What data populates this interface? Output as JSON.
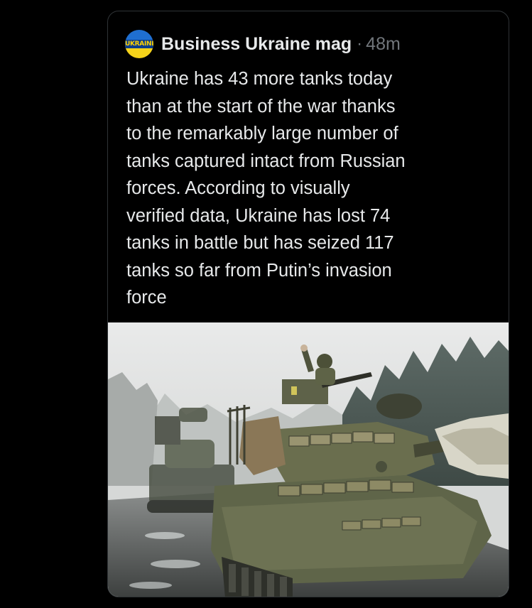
{
  "tweet": {
    "avatar_label": "UKRAINE",
    "author_name": "Business Ukraine mag",
    "separator": "·",
    "timestamp": "48m",
    "text": "Ukraine has 43 more tanks today\nthan at the start of the war thanks\nto the remarkably large number of\ntanks captured intact from Russian\nforces. According to visually\nverified data, Ukraine has lost 74\ntanks in battle but has seized 117\ntanks so far from Putin’s invasion\nforce"
  },
  "colors": {
    "background": "#000000",
    "text_primary": "#e7e9ea",
    "text_secondary": "#71767b",
    "card_border": "#2f3336"
  }
}
